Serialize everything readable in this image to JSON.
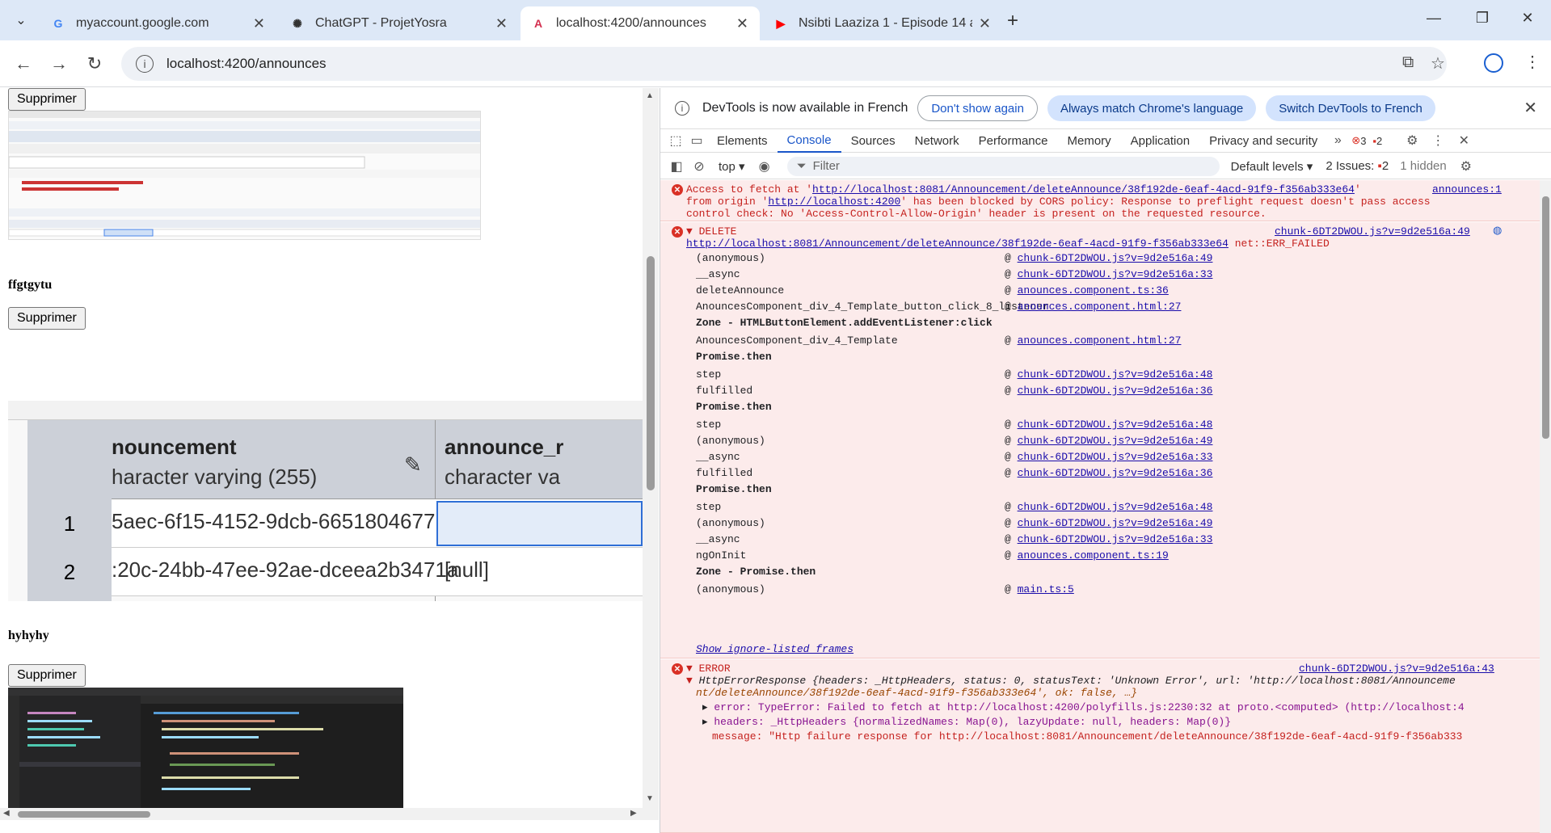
{
  "browser": {
    "tabs": [
      {
        "title": "myaccount.google.com",
        "favicon": "G",
        "active": false
      },
      {
        "title": "ChatGPT - ProjetYosra",
        "favicon": "✺",
        "active": false
      },
      {
        "title": "localhost:4200/announces",
        "favicon": "A",
        "active": true
      },
      {
        "title": "Nsibti Laaziza 1 - Episode 14 a",
        "favicon": "▶",
        "active": false
      }
    ],
    "url": "localhost:4200/announces"
  },
  "page": {
    "delete_label": "Supprimer",
    "items": [
      {
        "title": "ffgtgytu"
      },
      {
        "title": "hyhyhy"
      }
    ],
    "shot2": {
      "col1_name": "nouncement",
      "col1_type": "haracter varying (255)",
      "col2_name": "announce_r",
      "col2_type": "character va",
      "rows": [
        {
          "num": "1",
          "id": "5aec-6f15-4152-9dcb-6651804677…",
          "val": ""
        },
        {
          "num": "2",
          "id": ":20c-24bb-47ee-92ae-dceea2b3471a",
          "val": "[null]"
        }
      ]
    }
  },
  "devtools": {
    "info_message": "DevTools is now available in French",
    "btn_dont_show": "Don't show again",
    "btn_match": "Always match Chrome's language",
    "btn_switch": "Switch DevTools to French",
    "tabs": [
      "Elements",
      "Console",
      "Sources",
      "Network",
      "Performance",
      "Memory",
      "Application",
      "Privacy and security"
    ],
    "active_tab": "Console",
    "error_count": "3",
    "warning_count": "2",
    "context": "top",
    "filter_placeholder": "Filter",
    "levels": "Default levels ▾",
    "issues_label": "2 Issues:",
    "issues_count": "2",
    "hidden": "1 hidden",
    "cors": {
      "line1_pre": "Access to fetch at '",
      "url": "http://localhost:8081/Announcement/deleteAnnounce/38f192de-6eaf-4acd-91f9-f356ab333e64",
      "line1_post": "'",
      "source": "announces:1",
      "line2_pre": "from origin '",
      "origin": "http://localhost:4200",
      "line2_post": "' has been blocked by CORS policy: Response to preflight request doesn't pass access",
      "line3": "control check: No 'Access-Control-Allow-Origin' header is present on the requested resource."
    },
    "delete_msg": {
      "header": "DELETE",
      "source": "chunk-6DT2DWOU.js?v=9d2e516a:49",
      "url": "http://localhost:8081/Announcement/deleteAnnounce/38f192de-6eaf-4acd-91f9-f356ab333e64",
      "status": "net::ERR_FAILED",
      "frames": [
        {
          "fn": "(anonymous)",
          "src": "chunk-6DT2DWOU.js?v=9d2e516a:49"
        },
        {
          "fn": "__async",
          "src": "chunk-6DT2DWOU.js?v=9d2e516a:33"
        },
        {
          "fn": "deleteAnnounce",
          "src": "anounces.component.ts:36"
        },
        {
          "fn": "AnouncesComponent_div_4_Template_button_click_8_listener",
          "src": "anounces.component.html:27"
        },
        {
          "fn": "Zone - HTMLButtonElement.addEventListener:click",
          "src": "",
          "bold": true
        },
        {
          "fn": "AnouncesComponent_div_4_Template",
          "src": "anounces.component.html:27"
        },
        {
          "fn": "Promise.then",
          "src": "",
          "bold": true
        },
        {
          "fn": "step",
          "src": "chunk-6DT2DWOU.js?v=9d2e516a:48"
        },
        {
          "fn": "fulfilled",
          "src": "chunk-6DT2DWOU.js?v=9d2e516a:36"
        },
        {
          "fn": "Promise.then",
          "src": "",
          "bold": true
        },
        {
          "fn": "step",
          "src": "chunk-6DT2DWOU.js?v=9d2e516a:48"
        },
        {
          "fn": "(anonymous)",
          "src": "chunk-6DT2DWOU.js?v=9d2e516a:49"
        },
        {
          "fn": "__async",
          "src": "chunk-6DT2DWOU.js?v=9d2e516a:33"
        },
        {
          "fn": "fulfilled",
          "src": "chunk-6DT2DWOU.js?v=9d2e516a:36"
        },
        {
          "fn": "Promise.then",
          "src": "",
          "bold": true
        },
        {
          "fn": "step",
          "src": "chunk-6DT2DWOU.js?v=9d2e516a:48"
        },
        {
          "fn": "(anonymous)",
          "src": "chunk-6DT2DWOU.js?v=9d2e516a:49"
        },
        {
          "fn": "__async",
          "src": "chunk-6DT2DWOU.js?v=9d2e516a:33"
        },
        {
          "fn": "ngOnInit",
          "src": "anounces.component.ts:19"
        },
        {
          "fn": "Zone - Promise.then",
          "src": "",
          "bold": true
        },
        {
          "fn": "(anonymous)",
          "src": "main.ts:5"
        }
      ],
      "show_frames": "Show ignore-listed frames"
    },
    "error_msg": {
      "header": "ERROR",
      "source": "chunk-6DT2DWOU.js?v=9d2e516a:43",
      "obj_line1": "HttpErrorResponse {headers: _HttpHeaders, status: 0, statusText: 'Unknown Error', url: 'http://localhost:8081/Announceme",
      "obj_line2": "nt/deleteAnnounce/38f192de-6eaf-4acd-91f9-f356ab333e64', ok: false, …}",
      "error_line": "error: TypeError: Failed to fetch at http://localhost:4200/polyfills.js:2230:32 at proto.<computed> (http://localhost:4",
      "headers_line": "headers: _HttpHeaders {normalizedNames: Map(0), lazyUpdate: null, headers: Map(0)}",
      "message_line": "message: \"Http failure response for http://localhost:8081/Announcement/deleteAnnounce/38f192de-6eaf-4acd-91f9-f356ab333"
    }
  }
}
